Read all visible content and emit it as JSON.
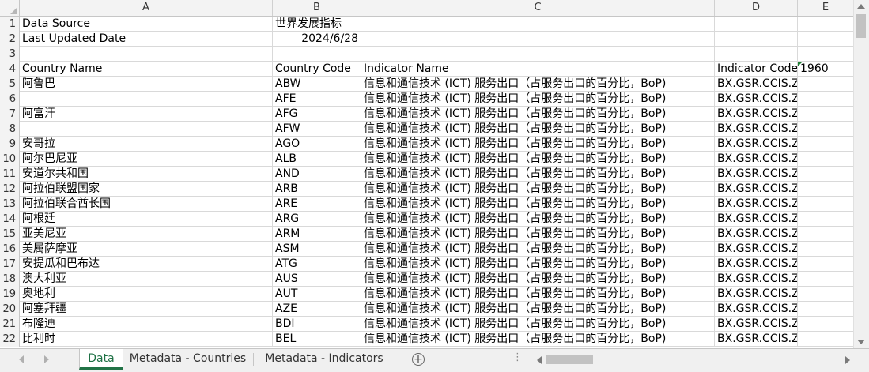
{
  "columns": [
    "A",
    "B",
    "C",
    "D",
    "E"
  ],
  "top_rows": [
    {
      "num": "1",
      "a": "Data Source",
      "b": "世界发展指标",
      "b_align": "left",
      "c": "",
      "d": "",
      "e": ""
    },
    {
      "num": "2",
      "a": "Last Updated Date",
      "b": "2024/6/28",
      "b_align": "right",
      "c": "",
      "d": "",
      "e": ""
    },
    {
      "num": "3",
      "a": "",
      "b": "",
      "b_align": "left",
      "c": "",
      "d": "",
      "e": ""
    },
    {
      "num": "4",
      "a": "Country Name",
      "b": "Country Code",
      "b_align": "left",
      "c": "Indicator Name",
      "d": "Indicator Code",
      "e": "1960"
    }
  ],
  "data_rows": [
    {
      "num": "5",
      "name": "阿鲁巴",
      "code": "ABW"
    },
    {
      "num": "6",
      "name": "",
      "code": "AFE"
    },
    {
      "num": "7",
      "name": "阿富汗",
      "code": "AFG"
    },
    {
      "num": "8",
      "name": "",
      "code": "AFW"
    },
    {
      "num": "9",
      "name": "安哥拉",
      "code": "AGO"
    },
    {
      "num": "10",
      "name": "阿尔巴尼亚",
      "code": "ALB"
    },
    {
      "num": "11",
      "name": "安道尔共和国",
      "code": "AND"
    },
    {
      "num": "12",
      "name": "阿拉伯联盟国家",
      "code": "ARB"
    },
    {
      "num": "13",
      "name": "阿拉伯联合酋长国",
      "code": "ARE"
    },
    {
      "num": "14",
      "name": "阿根廷",
      "code": "ARG"
    },
    {
      "num": "15",
      "name": "亚美尼亚",
      "code": "ARM"
    },
    {
      "num": "16",
      "name": "美属萨摩亚",
      "code": "ASM"
    },
    {
      "num": "17",
      "name": "安提瓜和巴布达",
      "code": "ATG"
    },
    {
      "num": "18",
      "name": "澳大利亚",
      "code": "AUS"
    },
    {
      "num": "19",
      "name": "奥地利",
      "code": "AUT"
    },
    {
      "num": "20",
      "name": "阿塞拜疆",
      "code": "AZE"
    },
    {
      "num": "21",
      "name": "布隆迪",
      "code": "BDI"
    },
    {
      "num": "22",
      "name": "比利时",
      "code": "BEL"
    }
  ],
  "indicator_name": "信息和通信技术 (ICT) 服务出口（占服务出口的百分比，BoP)",
  "indicator_code": "BX.GSR.CCIS.ZS",
  "sheet_tabs": [
    "Data",
    "Metadata - Countries",
    "Metadata - Indicators"
  ],
  "active_tab": "Data",
  "add_sheet_symbol": "+",
  "ellipsis": "⋮",
  "colors": {
    "accent": "#217346",
    "grid": "#d9d9d9",
    "header_bg": "#f3f3f3"
  }
}
